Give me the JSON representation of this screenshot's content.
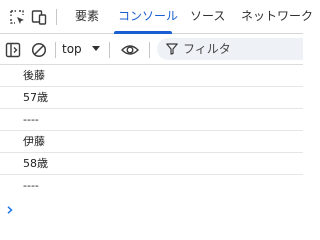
{
  "tabbar": {
    "tabs": [
      {
        "label": "要素"
      },
      {
        "label": "コンソール"
      },
      {
        "label": "ソース"
      },
      {
        "label": "ネットワーク"
      }
    ],
    "active_tab": "コンソール"
  },
  "toolbar": {
    "context": "top",
    "filter_placeholder": "フィルタ"
  },
  "console": {
    "lines": [
      "後藤",
      "57歳",
      "----",
      "伊藤",
      "58歳",
      "----"
    ]
  },
  "colors": {
    "accent": "#1a5fd1",
    "prompt": "#1a73e8"
  },
  "icons": [
    "inspect-element-icon",
    "device-toolbar-icon",
    "sidebar-toggle-icon",
    "clear-console-icon",
    "eye-icon",
    "filter-icon",
    "prompt-chevron-icon"
  ]
}
